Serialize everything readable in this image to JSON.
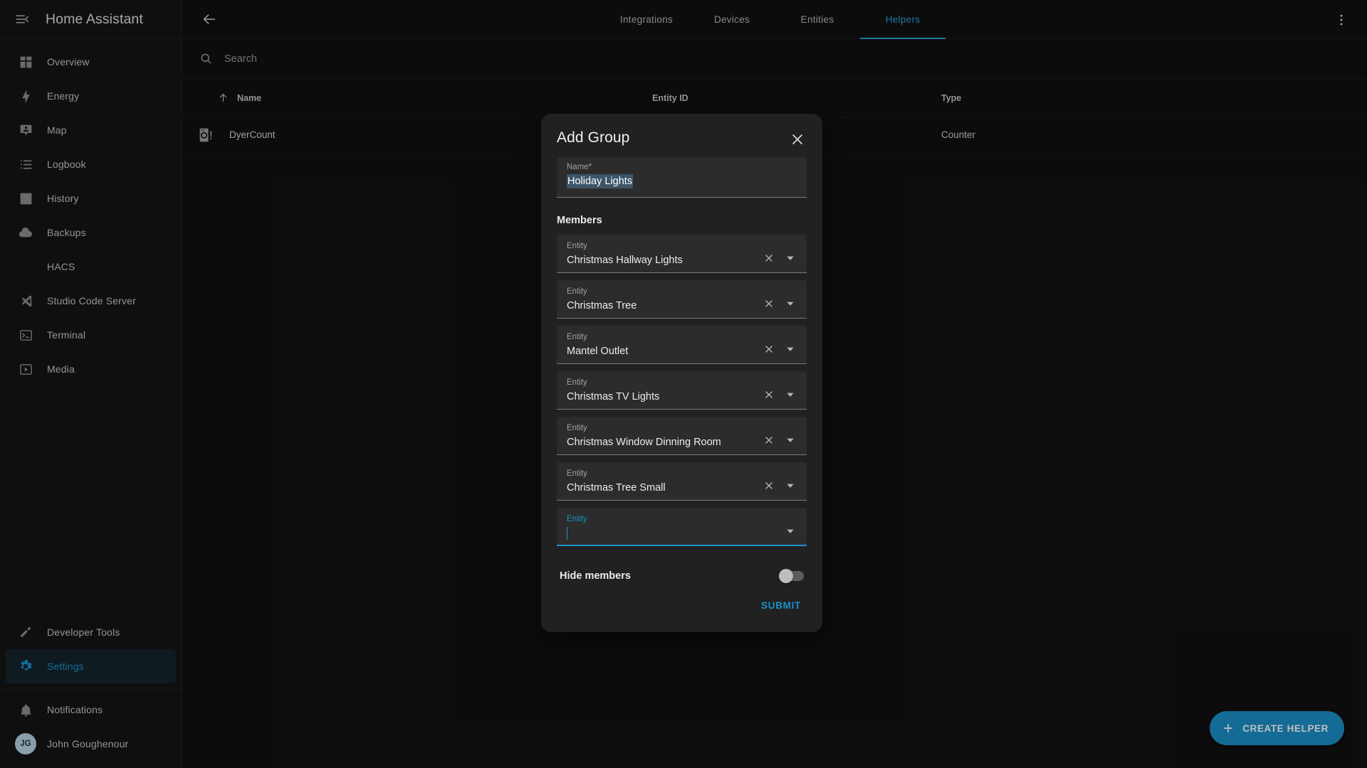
{
  "sidebar": {
    "title": "Home Assistant",
    "menu_icon": "menu-collapse-icon",
    "items": [
      {
        "label": "Overview",
        "icon": "view-dashboard-icon",
        "active": false
      },
      {
        "label": "Energy",
        "icon": "lightning-bolt-icon",
        "active": false
      },
      {
        "label": "Map",
        "icon": "map-marker-account-icon",
        "active": false
      },
      {
        "label": "Logbook",
        "icon": "format-list-bulleted-icon",
        "active": false
      },
      {
        "label": "History",
        "icon": "chart-box-icon",
        "active": false
      },
      {
        "label": "Backups",
        "icon": "cloud-icon",
        "active": false
      },
      {
        "label": "HACS",
        "icon": "",
        "active": false
      },
      {
        "label": "Studio Code Server",
        "icon": "vscode-icon",
        "active": false
      },
      {
        "label": "Terminal",
        "icon": "console-icon",
        "active": false
      },
      {
        "label": "Media",
        "icon": "play-box-icon",
        "active": false
      }
    ],
    "bottom_items": [
      {
        "label": "Developer Tools",
        "icon": "hammer-icon",
        "active": false
      },
      {
        "label": "Settings",
        "icon": "cog-icon",
        "active": true
      }
    ],
    "footer_items": [
      {
        "label": "Notifications",
        "icon": "bell-icon"
      }
    ],
    "user": {
      "name": "John Goughenour",
      "initials": "JG"
    }
  },
  "toolbar": {
    "back_icon": "arrow-left-icon",
    "overflow_icon": "dots-vertical-icon",
    "tabs": [
      {
        "label": "Integrations",
        "active": false
      },
      {
        "label": "Devices",
        "active": false
      },
      {
        "label": "Entities",
        "active": false
      },
      {
        "label": "Helpers",
        "active": true
      }
    ]
  },
  "search": {
    "placeholder": "Search",
    "value": "",
    "icon": "search-icon"
  },
  "table": {
    "columns": {
      "name": "Name",
      "entity_id": "Entity ID",
      "type": "Type"
    },
    "sort_icon": "arrow-up-icon",
    "rows": [
      {
        "icon": "washing-machine-alert-icon",
        "name": "DyerCount",
        "entity_id": "",
        "type": "Counter"
      }
    ]
  },
  "fab": {
    "label": "CREATE HELPER",
    "icon": "plus-icon",
    "color": "#1b8fc9"
  },
  "dialog": {
    "title": "Add Group",
    "close_icon": "close-icon",
    "name_field": {
      "label": "Name*",
      "value": "Holiday Lights",
      "selected": true
    },
    "members_title": "Members",
    "entity_label": "Entity",
    "clear_icon": "close-icon",
    "dropdown_icon": "menu-down-icon",
    "members": [
      {
        "label": "Entity",
        "value": "Christmas Hallway Lights"
      },
      {
        "label": "Entity",
        "value": "Christmas Tree"
      },
      {
        "label": "Entity",
        "value": "Mantel Outlet"
      },
      {
        "label": "Entity",
        "value": "Christmas TV Lights"
      },
      {
        "label": "Entity",
        "value": "Christmas Window Dinning Room"
      },
      {
        "label": "Entity",
        "value": "Christmas Tree Small"
      }
    ],
    "empty_member": {
      "label": "Entity",
      "value": "",
      "focused": true
    },
    "hide_members": {
      "label": "Hide members",
      "on": false
    },
    "submit_label": "SUBMIT",
    "accent_color": "#1b90c8"
  }
}
